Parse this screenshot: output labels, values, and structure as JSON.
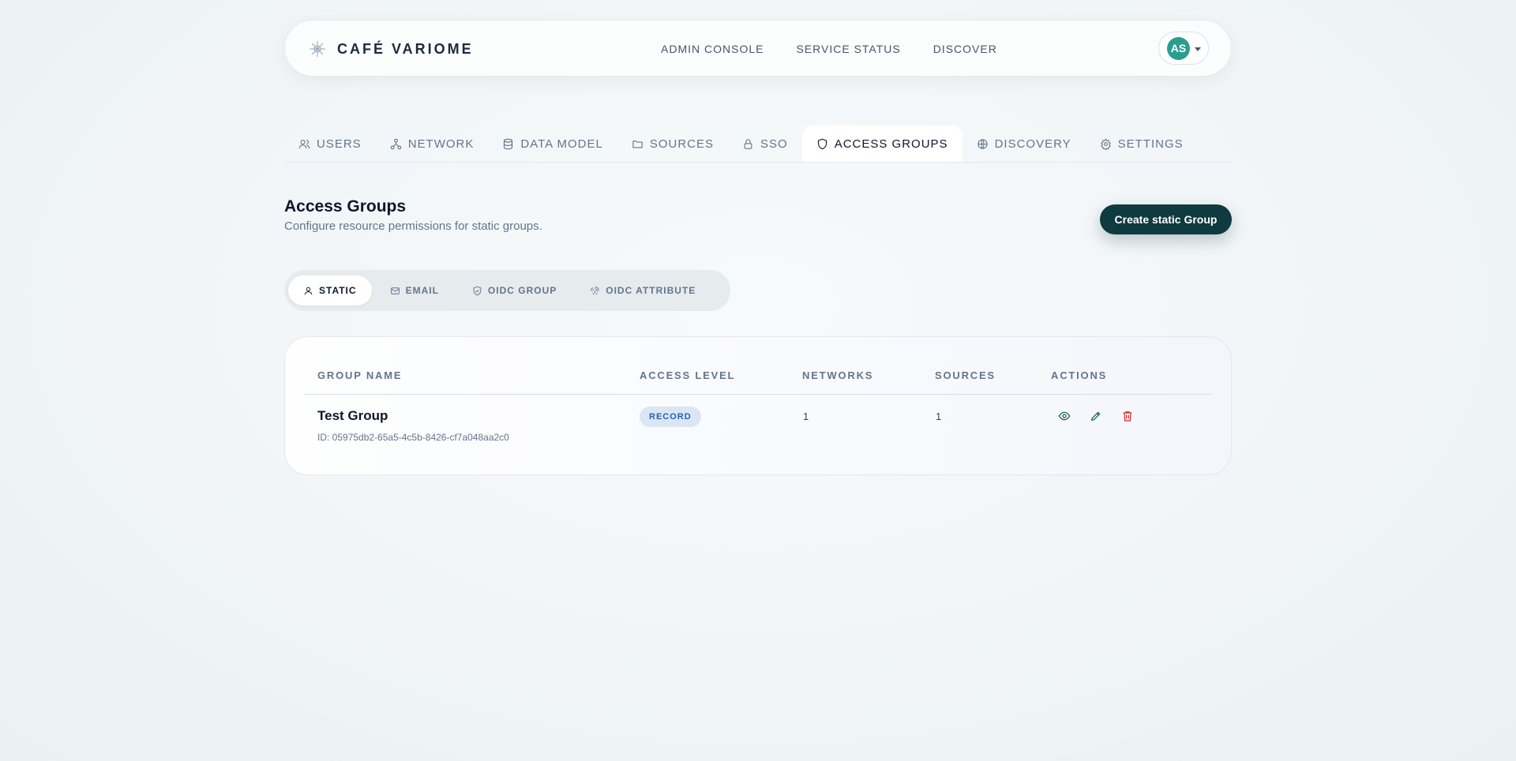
{
  "header": {
    "brand": "CAFÉ VARIOME",
    "nav": [
      "ADMIN CONSOLE",
      "SERVICE STATUS",
      "DISCOVER"
    ],
    "user_initials": "AS"
  },
  "tabs": [
    {
      "label": "USERS",
      "icon": "users-icon"
    },
    {
      "label": "NETWORK",
      "icon": "network-icon"
    },
    {
      "label": "DATA MODEL",
      "icon": "database-icon"
    },
    {
      "label": "SOURCES",
      "icon": "folder-icon"
    },
    {
      "label": "SSO",
      "icon": "lock-icon"
    },
    {
      "label": "ACCESS GROUPS",
      "icon": "shield-icon",
      "active": true
    },
    {
      "label": "DISCOVERY",
      "icon": "globe-icon"
    },
    {
      "label": "SETTINGS",
      "icon": "gear-icon"
    }
  ],
  "page": {
    "title": "Access Groups",
    "subtitle": "Configure resource permissions for static groups.",
    "create_label": "Create static Group"
  },
  "group_types": [
    {
      "label": "STATIC",
      "icon": "user-icon",
      "active": true
    },
    {
      "label": "EMAIL",
      "icon": "mail-icon"
    },
    {
      "label": "OIDC GROUP",
      "icon": "shield-check-icon"
    },
    {
      "label": "OIDC ATTRIBUTE",
      "icon": "fingerprint-icon"
    }
  ],
  "table": {
    "columns": [
      "GROUP NAME",
      "ACCESS LEVEL",
      "NETWORKS",
      "SOURCES",
      "ACTIONS"
    ],
    "rows": [
      {
        "name": "Test Group",
        "id": "ID: 05975db2-65a5-4c5b-8426-cf7a048aa2c0",
        "access_level": "RECORD",
        "networks": "1",
        "sources": "1"
      }
    ]
  },
  "colors": {
    "accent": "#0f3a3f",
    "avatar": "#2a9d8f",
    "badge_bg": "#dbe6f5",
    "badge_text": "#2563b0",
    "delete": "#dc2626",
    "view_edit": "#0f5c4f"
  }
}
